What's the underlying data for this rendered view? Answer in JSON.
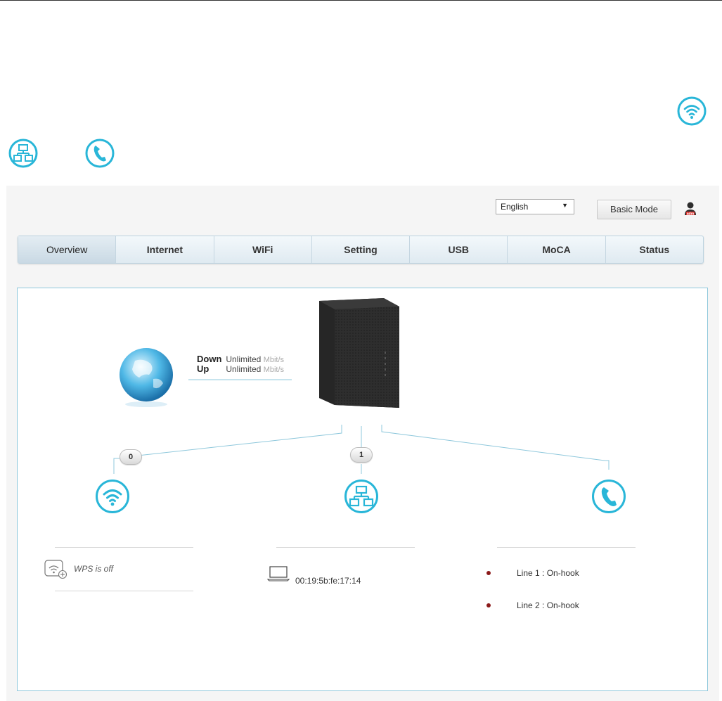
{
  "header": {
    "language": "English",
    "basic_mode_label": "Basic Mode",
    "user_icon": "user-icon"
  },
  "tabs": [
    {
      "label": "Overview",
      "active": true
    },
    {
      "label": "Internet",
      "active": false
    },
    {
      "label": "WiFi",
      "active": false
    },
    {
      "label": "Setting",
      "active": false
    },
    {
      "label": "USB",
      "active": false
    },
    {
      "label": "MoCA",
      "active": false
    },
    {
      "label": "Status",
      "active": false
    }
  ],
  "overview": {
    "internet": {
      "down_label": "Down",
      "down_value": "Unlimited",
      "up_label": "Up",
      "up_value": "Unlimited",
      "unit": "Mbit/s"
    },
    "wifi": {
      "count": "0",
      "wps_status": "WPS is off",
      "icon": "wifi-icon"
    },
    "lan": {
      "count": "1",
      "device_mac": "00:19:5b:fe:17:14",
      "icon": "lan-icon"
    },
    "phone": {
      "icon": "phone-icon",
      "lines": [
        "Line 1 : On-hook",
        "Line 2 : On-hook"
      ],
      "status_color": "#8b1a1a"
    }
  },
  "colors": {
    "accent": "#29b6d8",
    "tab_bg": "#dfeaf1",
    "border": "#8fc8dc"
  }
}
